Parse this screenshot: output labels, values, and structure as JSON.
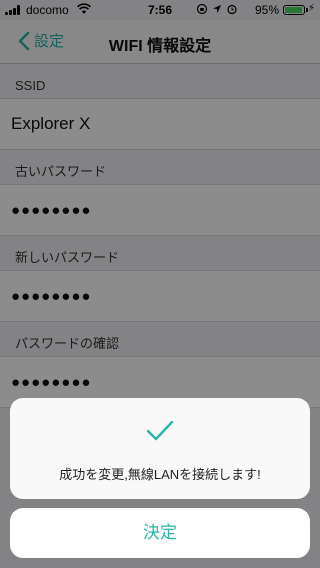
{
  "status_bar": {
    "carrier": "docomo",
    "time": "7:56",
    "battery_percent": "95%",
    "battery_level": 0.95,
    "icons": [
      "signal-icon",
      "wifi-icon",
      "rotation-lock-icon",
      "location-icon",
      "alarm-icon",
      "battery-icon",
      "charging-icon"
    ]
  },
  "nav": {
    "back_label": "設定",
    "title": "WIFI 情報設定"
  },
  "form": {
    "ssid": {
      "label": "SSID",
      "value": "Explorer X"
    },
    "old_password": {
      "label": "古いパスワード",
      "value": "●●●●●●●●"
    },
    "new_password": {
      "label": "新しいパスワード",
      "value": "●●●●●●●●"
    },
    "confirm_password": {
      "label": "パスワードの確認",
      "value": "●●●●●●●●"
    }
  },
  "alert": {
    "icon": "checkmark-icon",
    "message": "成功を変更,無線LANを接続します!",
    "confirm_label": "決定"
  },
  "colors": {
    "accent": "#2bb5a8",
    "battery": "#4cd964"
  }
}
